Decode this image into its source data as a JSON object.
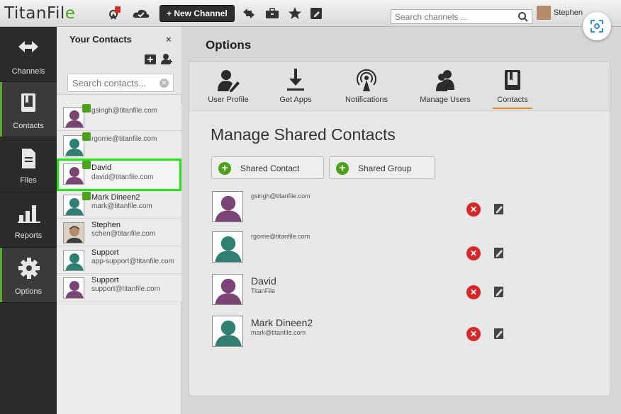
{
  "app": {
    "logo_text": "TitanFil",
    "logo_suffix": "e"
  },
  "toolbar": {
    "new_channel_label": "+ New Channel"
  },
  "search": {
    "placeholder": "Search channels ..."
  },
  "user": {
    "name": "Stephen"
  },
  "nav": {
    "items": [
      {
        "label": "Channels",
        "icon": "arrows-icon"
      },
      {
        "label": "Contacts",
        "icon": "book-icon"
      },
      {
        "label": "Files",
        "icon": "file-icon"
      },
      {
        "label": "Reports",
        "icon": "bar-chart-icon"
      },
      {
        "label": "Options",
        "icon": "gear-icon"
      }
    ]
  },
  "contacts_panel": {
    "title": "Your Contacts",
    "close": "×",
    "search_placeholder": "Search contacts...",
    "items": [
      {
        "name": "",
        "email": "gsingh@titanfile.com"
      },
      {
        "name": "",
        "email": "rgorrie@titanfile.com"
      },
      {
        "name": "David",
        "email": "david@titanfile.com"
      },
      {
        "name": "Mark Dineen2",
        "email": "mark@titanfile.com"
      },
      {
        "name": "Stephen",
        "email": "schen@titanfile.com"
      },
      {
        "name": "Support",
        "email": "app-support@titanfile.com"
      },
      {
        "name": "Support",
        "email": "support@titanfile.com"
      }
    ]
  },
  "main": {
    "title": "Options",
    "tabs": [
      {
        "label": "User Profile"
      },
      {
        "label": "Get Apps"
      },
      {
        "label": "Notifications"
      },
      {
        "label": "Manage Users"
      },
      {
        "label": "Contacts"
      }
    ],
    "section_title": "Manage Shared Contacts",
    "buttons": {
      "shared_contact": "Shared Contact",
      "shared_group": "Shared Group"
    },
    "shared_contacts": [
      {
        "name": "",
        "sub": "gsingh@titanfile.com"
      },
      {
        "name": "",
        "sub": "rgorrie@titanfile.com"
      },
      {
        "name": "David",
        "sub": "TitanFile"
      },
      {
        "name": "Mark Dineen2",
        "sub": "mark@titanfile.com"
      }
    ]
  },
  "colors": {
    "accent_green": "#4ea11d",
    "tab_underline": "#e08a1e",
    "delete_red": "#d62828",
    "selection_outline": "#22e516"
  }
}
